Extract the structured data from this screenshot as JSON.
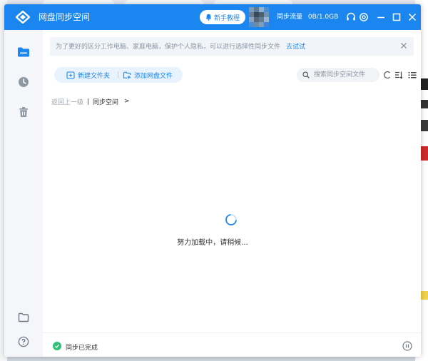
{
  "app": {
    "title": "网盘同步空间",
    "guide_button": "新手教程",
    "traffic": "同步流量",
    "traffic_value": "0B/1.0GB"
  },
  "icons": {
    "headset": "headset-icon",
    "settings": "gear-icon",
    "minimize": "minimize-icon",
    "maximize": "maximize-icon",
    "close": "close-icon"
  },
  "banner": {
    "text": "为了更好的区分工作电脑、家庭电脑，保护个人隐私，可以进行选择性同步文件",
    "link": "去试试"
  },
  "toolbar": {
    "new_folder": "新建文件夹",
    "add_cloud_file": "添加网盘文件",
    "search_placeholder": "搜索同步空间文件"
  },
  "breadcrumb": {
    "back": "返回上一级",
    "current": "同步空间",
    "arrow": ">"
  },
  "main": {
    "loading_text": "努力加载中，请稍候..."
  },
  "status": {
    "text": "同步已完成"
  },
  "colors": {
    "accent": "#1b86ef",
    "success": "#2fc17a",
    "sidebar": "#f4f6f9"
  }
}
